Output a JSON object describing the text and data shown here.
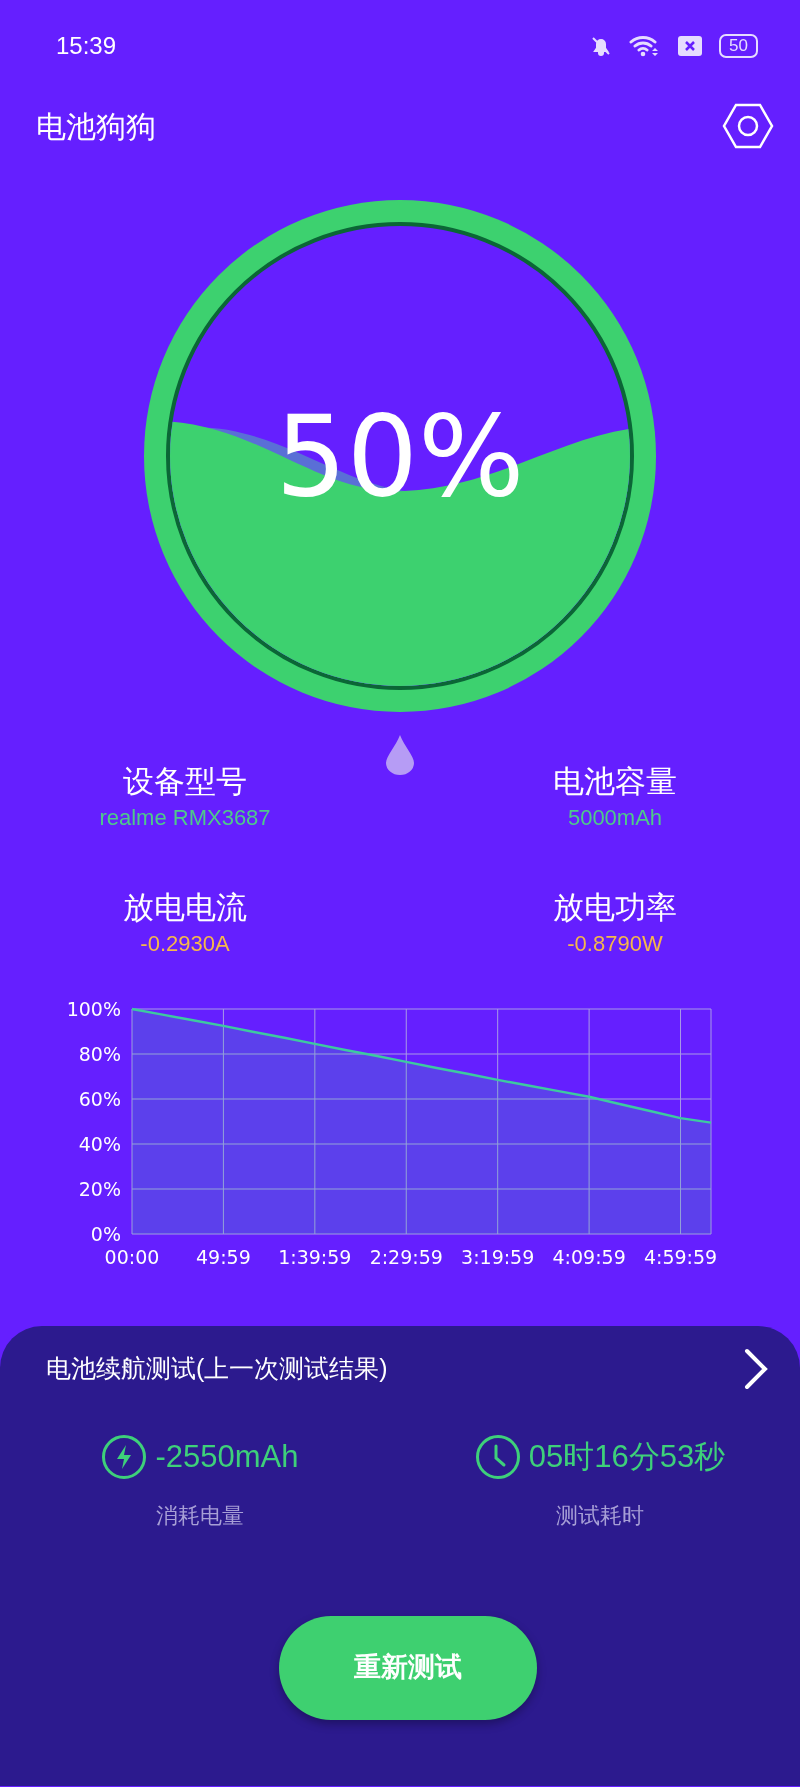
{
  "status_bar": {
    "time": "15:39",
    "battery": "50"
  },
  "app_bar": {
    "title": "电池狗狗"
  },
  "gauge": {
    "reading": "50%"
  },
  "info": [
    {
      "label": "设备型号",
      "value": "realme RMX3687",
      "color": "#4fc98a"
    },
    {
      "label": "电池容量",
      "value": "5000mAh",
      "color": "#4fc98a"
    },
    {
      "label": "放电电流",
      "value": "-0.2930A",
      "color": "#f5b84a"
    },
    {
      "label": "放电功率",
      "value": "-0.8790W",
      "color": "#f5b84a"
    }
  ],
  "chart": {
    "chart_data": {
      "type": "area",
      "grid": true,
      "categories": [
        "00:00",
        null,
        null,
        "49:59",
        null,
        null,
        "1:39:59",
        null,
        null,
        "2:29:59",
        null,
        null,
        "3:19:59",
        null,
        null,
        "4:09:59",
        null,
        null,
        "4:59:59",
        null
      ],
      "series": [
        {
          "color": "#3ec9a0",
          "values": [
            100,
            97.5,
            95,
            92.5,
            89.8,
            87.2,
            84.5,
            81.8,
            79.2,
            76.5,
            73.8,
            71.2,
            68.5,
            66,
            63.5,
            61,
            57.8,
            54.7,
            51.5,
            49.5
          ]
        }
      ],
      "ylim": [
        0,
        100
      ],
      "yticks": [
        {
          "value": 0,
          "label": "0%"
        },
        {
          "value": 20,
          "label": "20%"
        },
        {
          "value": 40,
          "label": "40%"
        },
        {
          "value": 60,
          "label": "60%"
        },
        {
          "value": 80,
          "label": "80%"
        },
        {
          "value": 100,
          "label": "100%"
        }
      ]
    }
  },
  "endurance_test": {
    "title": "电池续航测试(上一次测试结果)",
    "stats": [
      {
        "kind": "energy",
        "value": "-2550mAh",
        "label": "消耗电量"
      },
      {
        "kind": "duration",
        "value": "05时16分53秒",
        "label": "测试耗时"
      }
    ],
    "button": "重新测试"
  }
}
